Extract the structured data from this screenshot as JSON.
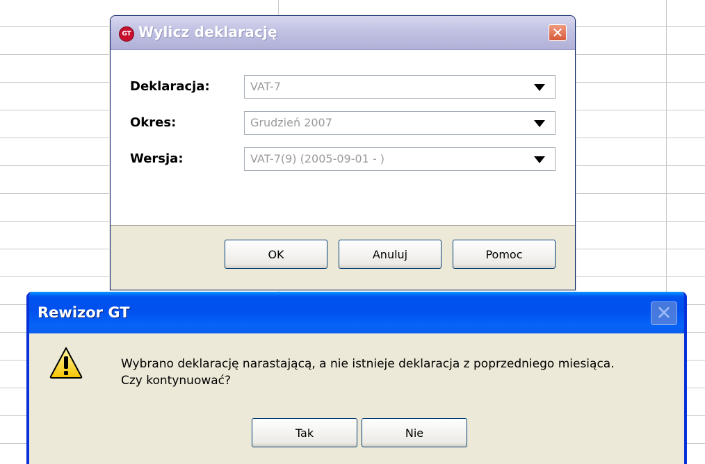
{
  "dialog_main": {
    "title": "Wylicz deklarację",
    "icon": "gt-logo-icon",
    "close_label": "✕",
    "fields": [
      {
        "label": "Deklaracja:",
        "value": "VAT-7"
      },
      {
        "label": "Okres:",
        "value": "Grudzień 2007"
      },
      {
        "label": "Wersja:",
        "value": "VAT-7(9) (2005-09-01 - )"
      }
    ],
    "buttons": {
      "ok": "OK",
      "cancel": "Anuluj",
      "help": "Pomoc"
    }
  },
  "dialog_message": {
    "title": "Rewizor GT",
    "close_label": "✕",
    "icon": "warning-icon",
    "message_line1": "Wybrano deklarację narastającą, a nie istnieje deklaracja z poprzedniego miesiąca.",
    "message_line2": "Czy kontynuować?",
    "buttons": {
      "yes": "Tak",
      "no": "Nie"
    }
  },
  "colors": {
    "xp_blue": "#0054e3",
    "inactive_title": "#c3c3e4",
    "dialog_face": "#ece9d8",
    "warning_yellow": "#ffd800"
  }
}
